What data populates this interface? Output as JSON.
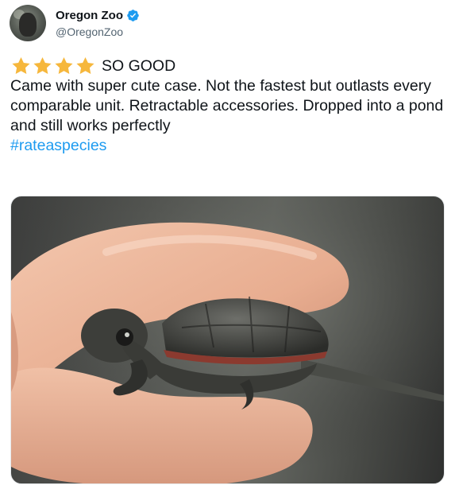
{
  "tweet": {
    "author": {
      "display_name": "Oregon Zoo",
      "handle": "@OregonZoo",
      "verified": true,
      "verified_color": "#1d9bf0"
    },
    "rating": {
      "stars": 4,
      "star_color": "#f6b73c",
      "title": "SO GOOD"
    },
    "review_text": "Came with super cute case. Not the fastest but outlasts every comparable unit. Retractable accessories. Dropped into a pond and still works perfectly",
    "hashtag": "#rateaspecies",
    "hashtag_color": "#1d9bf0"
  }
}
